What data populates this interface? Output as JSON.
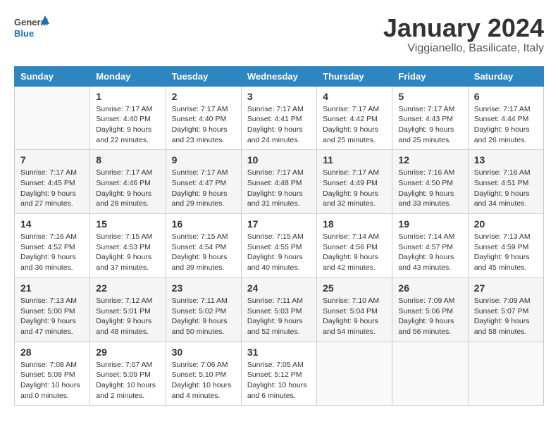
{
  "header": {
    "logo_general": "General",
    "logo_blue": "Blue",
    "month_title": "January 2024",
    "location": "Viggianello, Basilicate, Italy"
  },
  "calendar": {
    "days_of_week": [
      "Sunday",
      "Monday",
      "Tuesday",
      "Wednesday",
      "Thursday",
      "Friday",
      "Saturday"
    ],
    "weeks": [
      [
        {
          "day": "",
          "sunrise": "",
          "sunset": "",
          "daylight": ""
        },
        {
          "day": "1",
          "sunrise": "Sunrise: 7:17 AM",
          "sunset": "Sunset: 4:40 PM",
          "daylight": "Daylight: 9 hours and 22 minutes."
        },
        {
          "day": "2",
          "sunrise": "Sunrise: 7:17 AM",
          "sunset": "Sunset: 4:40 PM",
          "daylight": "Daylight: 9 hours and 23 minutes."
        },
        {
          "day": "3",
          "sunrise": "Sunrise: 7:17 AM",
          "sunset": "Sunset: 4:41 PM",
          "daylight": "Daylight: 9 hours and 24 minutes."
        },
        {
          "day": "4",
          "sunrise": "Sunrise: 7:17 AM",
          "sunset": "Sunset: 4:42 PM",
          "daylight": "Daylight: 9 hours and 25 minutes."
        },
        {
          "day": "5",
          "sunrise": "Sunrise: 7:17 AM",
          "sunset": "Sunset: 4:43 PM",
          "daylight": "Daylight: 9 hours and 25 minutes."
        },
        {
          "day": "6",
          "sunrise": "Sunrise: 7:17 AM",
          "sunset": "Sunset: 4:44 PM",
          "daylight": "Daylight: 9 hours and 26 minutes."
        }
      ],
      [
        {
          "day": "7",
          "sunrise": "Sunrise: 7:17 AM",
          "sunset": "Sunset: 4:45 PM",
          "daylight": "Daylight: 9 hours and 27 minutes."
        },
        {
          "day": "8",
          "sunrise": "Sunrise: 7:17 AM",
          "sunset": "Sunset: 4:46 PM",
          "daylight": "Daylight: 9 hours and 28 minutes."
        },
        {
          "day": "9",
          "sunrise": "Sunrise: 7:17 AM",
          "sunset": "Sunset: 4:47 PM",
          "daylight": "Daylight: 9 hours and 29 minutes."
        },
        {
          "day": "10",
          "sunrise": "Sunrise: 7:17 AM",
          "sunset": "Sunset: 4:48 PM",
          "daylight": "Daylight: 9 hours and 31 minutes."
        },
        {
          "day": "11",
          "sunrise": "Sunrise: 7:17 AM",
          "sunset": "Sunset: 4:49 PM",
          "daylight": "Daylight: 9 hours and 32 minutes."
        },
        {
          "day": "12",
          "sunrise": "Sunrise: 7:16 AM",
          "sunset": "Sunset: 4:50 PM",
          "daylight": "Daylight: 9 hours and 33 minutes."
        },
        {
          "day": "13",
          "sunrise": "Sunrise: 7:16 AM",
          "sunset": "Sunset: 4:51 PM",
          "daylight": "Daylight: 9 hours and 34 minutes."
        }
      ],
      [
        {
          "day": "14",
          "sunrise": "Sunrise: 7:16 AM",
          "sunset": "Sunset: 4:52 PM",
          "daylight": "Daylight: 9 hours and 36 minutes."
        },
        {
          "day": "15",
          "sunrise": "Sunrise: 7:15 AM",
          "sunset": "Sunset: 4:53 PM",
          "daylight": "Daylight: 9 hours and 37 minutes."
        },
        {
          "day": "16",
          "sunrise": "Sunrise: 7:15 AM",
          "sunset": "Sunset: 4:54 PM",
          "daylight": "Daylight: 9 hours and 39 minutes."
        },
        {
          "day": "17",
          "sunrise": "Sunrise: 7:15 AM",
          "sunset": "Sunset: 4:55 PM",
          "daylight": "Daylight: 9 hours and 40 minutes."
        },
        {
          "day": "18",
          "sunrise": "Sunrise: 7:14 AM",
          "sunset": "Sunset: 4:56 PM",
          "daylight": "Daylight: 9 hours and 42 minutes."
        },
        {
          "day": "19",
          "sunrise": "Sunrise: 7:14 AM",
          "sunset": "Sunset: 4:57 PM",
          "daylight": "Daylight: 9 hours and 43 minutes."
        },
        {
          "day": "20",
          "sunrise": "Sunrise: 7:13 AM",
          "sunset": "Sunset: 4:59 PM",
          "daylight": "Daylight: 9 hours and 45 minutes."
        }
      ],
      [
        {
          "day": "21",
          "sunrise": "Sunrise: 7:13 AM",
          "sunset": "Sunset: 5:00 PM",
          "daylight": "Daylight: 9 hours and 47 minutes."
        },
        {
          "day": "22",
          "sunrise": "Sunrise: 7:12 AM",
          "sunset": "Sunset: 5:01 PM",
          "daylight": "Daylight: 9 hours and 48 minutes."
        },
        {
          "day": "23",
          "sunrise": "Sunrise: 7:11 AM",
          "sunset": "Sunset: 5:02 PM",
          "daylight": "Daylight: 9 hours and 50 minutes."
        },
        {
          "day": "24",
          "sunrise": "Sunrise: 7:11 AM",
          "sunset": "Sunset: 5:03 PM",
          "daylight": "Daylight: 9 hours and 52 minutes."
        },
        {
          "day": "25",
          "sunrise": "Sunrise: 7:10 AM",
          "sunset": "Sunset: 5:04 PM",
          "daylight": "Daylight: 9 hours and 54 minutes."
        },
        {
          "day": "26",
          "sunrise": "Sunrise: 7:09 AM",
          "sunset": "Sunset: 5:06 PM",
          "daylight": "Daylight: 9 hours and 56 minutes."
        },
        {
          "day": "27",
          "sunrise": "Sunrise: 7:09 AM",
          "sunset": "Sunset: 5:07 PM",
          "daylight": "Daylight: 9 hours and 58 minutes."
        }
      ],
      [
        {
          "day": "28",
          "sunrise": "Sunrise: 7:08 AM",
          "sunset": "Sunset: 5:08 PM",
          "daylight": "Daylight: 10 hours and 0 minutes."
        },
        {
          "day": "29",
          "sunrise": "Sunrise: 7:07 AM",
          "sunset": "Sunset: 5:09 PM",
          "daylight": "Daylight: 10 hours and 2 minutes."
        },
        {
          "day": "30",
          "sunrise": "Sunrise: 7:06 AM",
          "sunset": "Sunset: 5:10 PM",
          "daylight": "Daylight: 10 hours and 4 minutes."
        },
        {
          "day": "31",
          "sunrise": "Sunrise: 7:05 AM",
          "sunset": "Sunset: 5:12 PM",
          "daylight": "Daylight: 10 hours and 6 minutes."
        },
        {
          "day": "",
          "sunrise": "",
          "sunset": "",
          "daylight": ""
        },
        {
          "day": "",
          "sunrise": "",
          "sunset": "",
          "daylight": ""
        },
        {
          "day": "",
          "sunrise": "",
          "sunset": "",
          "daylight": ""
        }
      ]
    ]
  }
}
